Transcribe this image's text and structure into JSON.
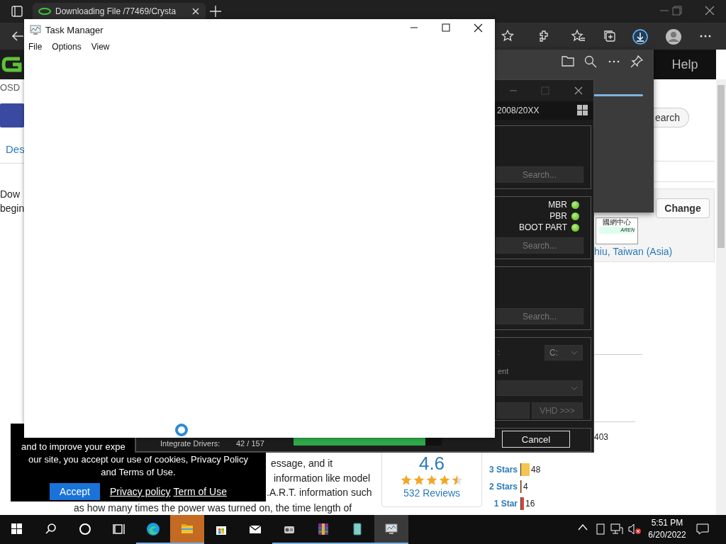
{
  "browser": {
    "tab_title": "Downloading File /77469/Crysta",
    "page": {
      "help_link": "Help",
      "site_label": "OSD",
      "nav_link": "Des",
      "intro_lines": [
        "Dow",
        "begin"
      ],
      "search_button": "earch",
      "change_button": "Change",
      "mirror_logo_title": "國網中心",
      "mirror_logo_caption": "AREN",
      "mirror_location": "hiu, Taiwan (Asia)",
      "body_lines": [
        "essage, and it",
        "information like model",
        ".A.R.T. information such",
        "as how many times the power was turned on, the time length of"
      ],
      "rating": {
        "score": "4.6",
        "stars": 4.5,
        "reviews": "532 Reviews"
      },
      "top_count": "403",
      "star_rows": [
        {
          "label": "3 Stars",
          "count": "48",
          "level": 0.12,
          "color": "#f5c451"
        },
        {
          "label": "2 Stars",
          "count": "4",
          "level": 0.01,
          "color": "#e8a03c"
        },
        {
          "label": "1 Star",
          "count": "16",
          "level": 0.04,
          "color": "#d9463a"
        }
      ]
    }
  },
  "cookie_banner": {
    "lines": [
      "and to improve your expe",
      "our site, you accept our use of cookies, Privacy Policy",
      "and Terms of Use."
    ],
    "accept": "Accept",
    "links": [
      "Privacy policy",
      "Term of Use"
    ]
  },
  "downloads": {
    "level": 1
  },
  "tool_window": {
    "subtitle": "2008/20XX",
    "search_buttons": [
      "Search...",
      "Search...",
      "Search..."
    ],
    "partitions": [
      {
        "label": "MBR",
        "on": true
      },
      {
        "label": "PBR",
        "on": true
      },
      {
        "label": "BOOT PART",
        "on": true
      }
    ],
    "drive_label": ":",
    "drive": "C:",
    "target_label": "ent",
    "vhd_button": "VHD >>>",
    "cancel_button": "Cancel",
    "progress": {
      "label": "Integrate Drivers:",
      "count": "42 / 157",
      "level": 0.89
    }
  },
  "task_manager": {
    "title": "Task Manager",
    "menu": [
      "File",
      "Options",
      "View"
    ]
  },
  "taskbar": {
    "items": [
      {
        "kind": "start",
        "running": false,
        "selected": false,
        "attention": false
      },
      {
        "kind": "search",
        "running": false,
        "selected": false,
        "attention": false
      },
      {
        "kind": "cortana",
        "running": false,
        "selected": false,
        "attention": false
      },
      {
        "kind": "taskview",
        "running": false,
        "selected": false,
        "attention": false
      },
      {
        "kind": "edge",
        "running": true,
        "selected": false,
        "attention": false
      },
      {
        "kind": "explorer",
        "running": true,
        "selected": false,
        "attention": true
      },
      {
        "kind": "store",
        "running": false,
        "selected": false,
        "attention": false
      },
      {
        "kind": "mail",
        "running": false,
        "selected": false,
        "attention": false
      },
      {
        "kind": "app",
        "running": true,
        "selected": false,
        "attention": false
      },
      {
        "kind": "archive",
        "running": true,
        "selected": false,
        "attention": false
      },
      {
        "kind": "tablet",
        "running": true,
        "selected": false,
        "attention": false
      },
      {
        "kind": "monitor",
        "running": true,
        "selected": true,
        "attention": false
      }
    ],
    "time": "5:51 PM",
    "date": "6/20/2022"
  }
}
